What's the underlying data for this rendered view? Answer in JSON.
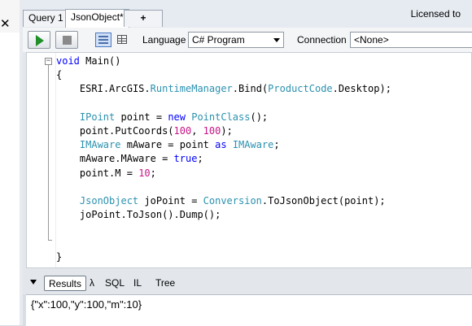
{
  "sidebar": {
    "close_glyph": "✕"
  },
  "tabs": [
    {
      "label": "Query 1",
      "active": false
    },
    {
      "label": "JsonObject*",
      "active": true
    },
    {
      "label": "+",
      "active": false
    }
  ],
  "license_text": "Licensed to",
  "toolbar": {
    "language_label": "Language",
    "language_value": "C# Program",
    "connection_label": "Connection",
    "connection_value": "<None>"
  },
  "code": {
    "lines": [
      "void Main()",
      "{",
      "    ESRI.ArcGIS.RuntimeManager.Bind(ProductCode.Desktop);",
      "",
      "    IPoint point = new PointClass();",
      "    point.PutCoords(100, 100);",
      "    IMAware mAware = point as IMAware;",
      "    mAware.MAware = true;",
      "    point.M = 10;",
      "",
      "    JsonObject joPoint = Conversion.ToJsonObject(point);",
      "    joPoint.ToJson().Dump();",
      "",
      "",
      "}"
    ],
    "keyword_color": "#0000ff",
    "type_color": "#2b91af"
  },
  "results_tabs": [
    "Results",
    "λ",
    "SQL",
    "IL",
    "Tree"
  ],
  "results_output": "{\"x\":100,\"y\":100,\"m\":10}",
  "colors": {
    "run_green": "#1f8f2a",
    "selection_blue": "#cfe0f7"
  }
}
